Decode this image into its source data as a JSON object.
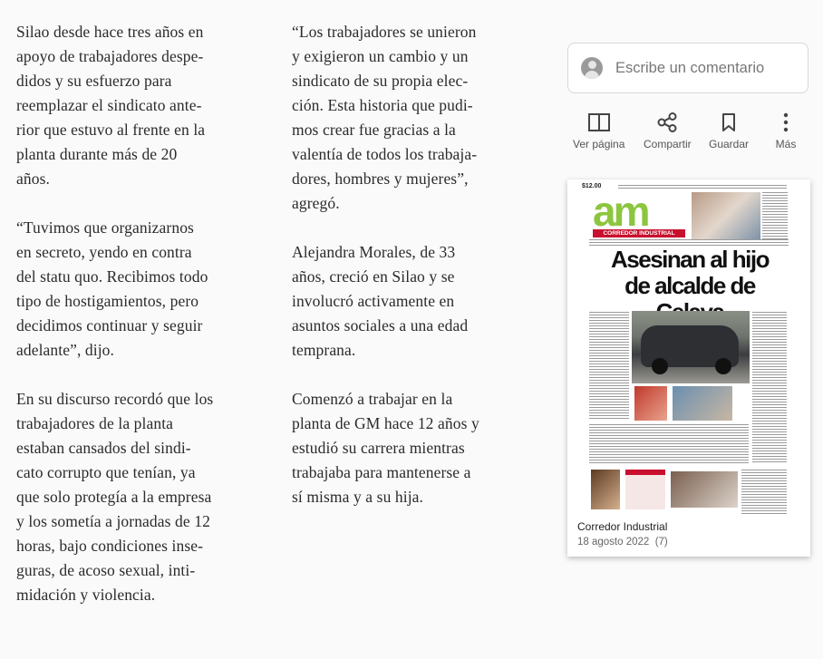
{
  "article": {
    "col1": [
      [
        "Silao desde hace tres años en",
        "apoyo de trabajadores despe-",
        "didos y su esfuerzo para",
        "reemplazar el sindicato ante-",
        "rior que estuvo al frente en la",
        "planta durante más de 20",
        "años."
      ],
      [
        "“Tuvimos que organizarnos",
        "en secreto, yendo en contra",
        "del statu quo. Recibimos todo",
        "tipo de hostigamientos, pero",
        "decidimos continuar y seguir",
        "adelante”, dijo."
      ],
      [
        "En su discurso recordó que los",
        "trabajadores de la planta",
        "estaban cansados del sindi-",
        "cato corrupto que tenían, ya",
        "que solo protegía a la empresa",
        "y los sometía a jornadas de 12",
        "horas, bajo condiciones inse-",
        "guras, de acoso sexual, inti-",
        "midación y violencia."
      ]
    ],
    "col2": [
      [
        "“Los trabajadores se unieron",
        "y exigieron un cambio y un",
        "sindicato de su propia elec-",
        "ción. Esta historia que pudi-",
        "mos crear fue gracias a la",
        "valentía de todos los trabaja-",
        "dores, hombres y mujeres”,",
        "agregó."
      ],
      [
        "Alejandra Morales, de 33",
        "años, creció en Silao y se",
        "involucró activamente en",
        "asuntos sociales a una edad",
        "temprana."
      ],
      [
        "Comenzó a trabajar en la",
        "planta de GM hace 12 años y",
        "estudió su carrera mientras",
        "trabajaba para mantenerse a",
        "sí misma y a su hija."
      ]
    ]
  },
  "comment": {
    "placeholder": "Escribe un comentario"
  },
  "actions": [
    {
      "icon": "book-open-icon",
      "label": "Ver página"
    },
    {
      "icon": "share-icon",
      "label": "Compartir"
    },
    {
      "icon": "bookmark-icon",
      "label": "Guardar"
    },
    {
      "icon": "more-vertical-icon",
      "label": "Más"
    }
  ],
  "newspaper": {
    "price": "$12.00",
    "logo": "am",
    "edition_band": "CORREDOR INDUSTRIAL",
    "headline": [
      "Asesinan al hijo",
      "de alcalde de Celaya"
    ],
    "caption_title": "Corredor Industrial",
    "caption_date": "18 agosto 2022",
    "caption_count": "(7)"
  },
  "colors": {
    "accent_logo": "#8cc63f",
    "accent_red": "#c8102e"
  }
}
